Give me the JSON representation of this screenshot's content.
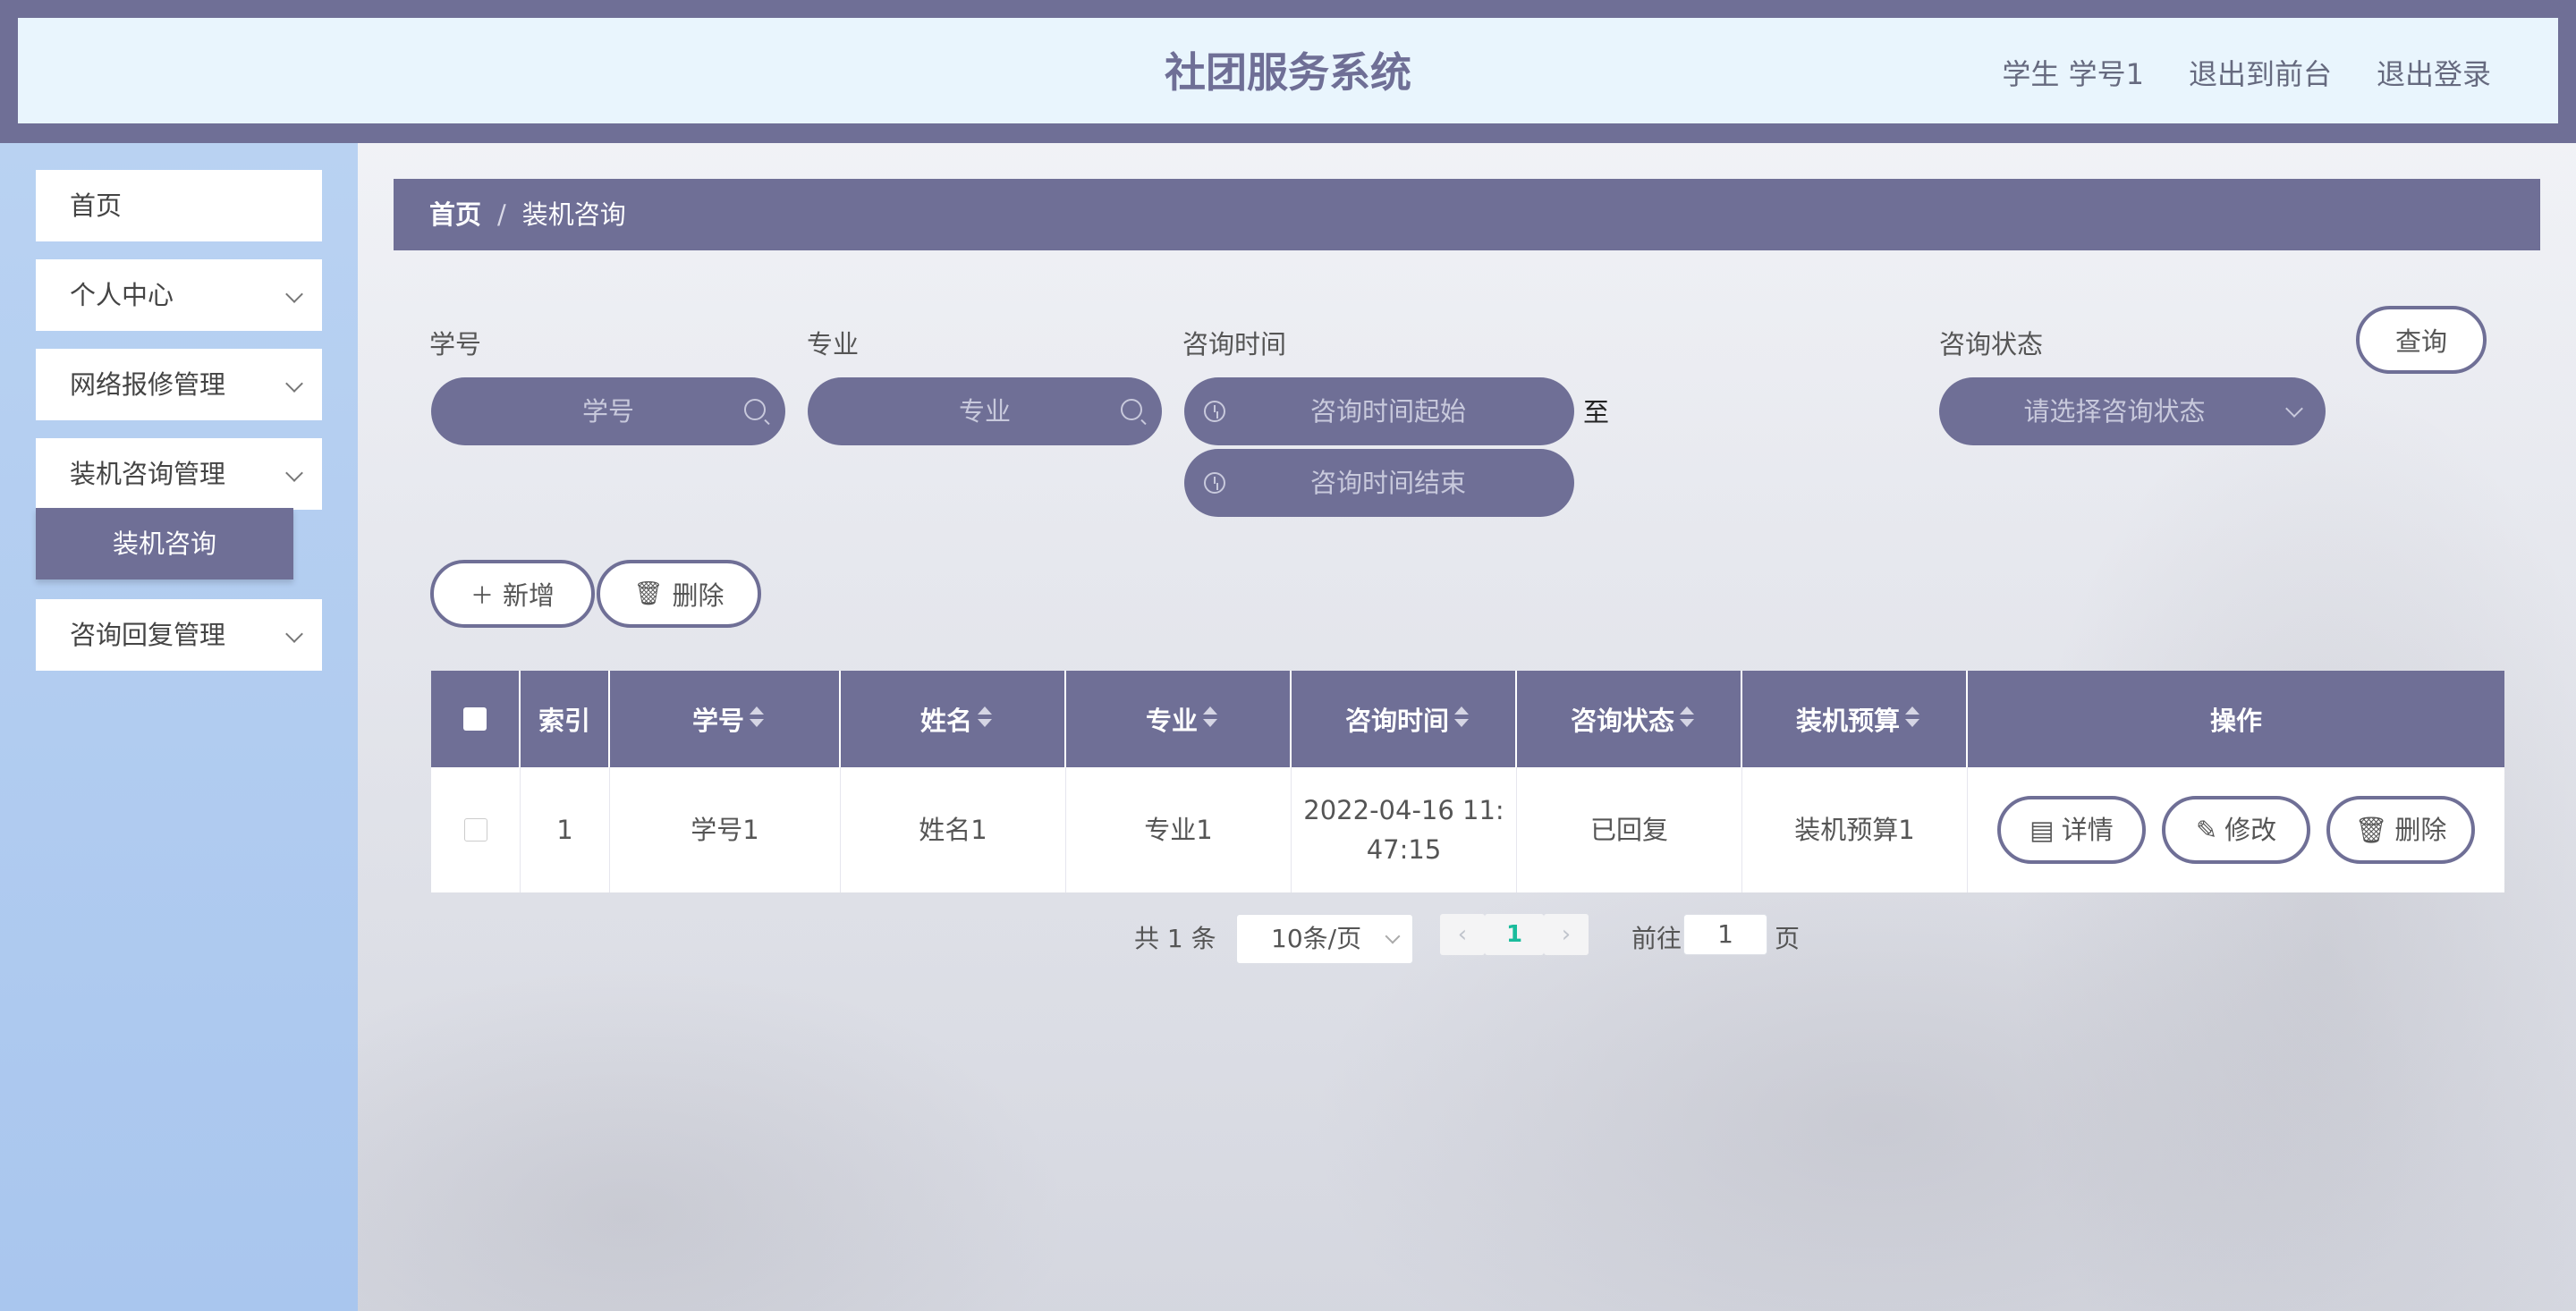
{
  "header": {
    "title": "社团服务系统",
    "user_label": "学生 学号1",
    "to_frontend": "退出到前台",
    "logout": "退出登录"
  },
  "sidebar": {
    "items": [
      {
        "label": "首页"
      },
      {
        "label": "个人中心"
      },
      {
        "label": "网络报修管理"
      },
      {
        "label": "装机咨询管理"
      },
      {
        "label": "咨询回复管理"
      }
    ],
    "active_sub": "装机咨询"
  },
  "breadcrumb": {
    "home": "首页",
    "sep": "/",
    "current": "装机咨询"
  },
  "filters": {
    "student_id": {
      "label": "学号",
      "placeholder": "学号"
    },
    "major": {
      "label": "专业",
      "placeholder": "专业"
    },
    "time": {
      "label": "咨询时间",
      "start": "咨询时间起始",
      "end": "咨询时间结束",
      "to": "至"
    },
    "status": {
      "label": "咨询状态",
      "placeholder": "请选择咨询状态"
    },
    "query_button": "查询"
  },
  "actions": {
    "add": "新增",
    "delete": "删除"
  },
  "table": {
    "columns": [
      "索引",
      "学号",
      "姓名",
      "专业",
      "咨询时间",
      "咨询状态",
      "装机预算",
      "操作"
    ],
    "rows": [
      {
        "index": "1",
        "student_id": "学号1",
        "name": "姓名1",
        "major": "专业1",
        "time": "2022-04-16 11:47:15",
        "time_l1": "2022-04-16 11:",
        "time_l2": "47:15",
        "status": "已回复",
        "budget": "装机预算1"
      }
    ],
    "row_actions": {
      "detail": "详情",
      "edit": "修改",
      "delete": "删除"
    }
  },
  "pagination": {
    "total": "共 1 条",
    "page_size": "10条/页",
    "current_page": "1",
    "goto_label": "前往",
    "goto_value": "1",
    "page_suffix": "页"
  },
  "colors": {
    "primary": "#6f6f96",
    "header_bg": "#e9f5fd",
    "sidebar_bg": "#b9d2f2",
    "page_active": "#1abc9c"
  }
}
